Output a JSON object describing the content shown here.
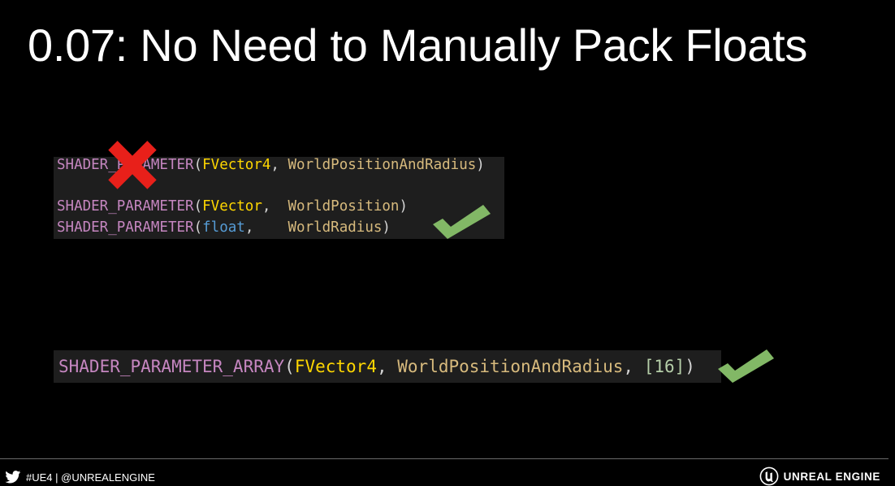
{
  "slide": {
    "title": "0.07: No Need to Manually Pack Floats"
  },
  "code_block_1": {
    "line_1": {
      "macro": "SHADER_PARAMETER",
      "open": "(",
      "type": "FVector4",
      "sep": ", ",
      "name": "WorldPositionAndRadius",
      "close": ")"
    },
    "line_2": {
      "macro": "SHADER_PARAMETER",
      "open": "(",
      "type": "FVector",
      "sep": ",  ",
      "name": "WorldPosition",
      "close": ")"
    },
    "line_3": {
      "macro": "SHADER_PARAMETER",
      "open": "(",
      "type": "float",
      "sep": ",    ",
      "name": "WorldRadius",
      "close": ")"
    }
  },
  "code_block_2": {
    "line_1": {
      "macro": "SHADER_PARAMETER_ARRAY",
      "open": "(",
      "type": "FVector4",
      "sep_1": ", ",
      "name": "WorldPositionAndRadius",
      "sep_2": ", ",
      "size": "[16]",
      "close": ")"
    }
  },
  "marks": {
    "cross_icon": "red-cross-icon",
    "check_icon": "green-check-icon",
    "cross_color": "#e8201a",
    "check_color": "#82b866"
  },
  "footer": {
    "social_icon": "twitter-bird-icon",
    "hashtag_text": "#UE4 | @UNREALENGINE",
    "brand_icon": "unreal-engine-logo-icon",
    "brand_text": "UNREAL ENGINE"
  },
  "colors": {
    "background": "#000000",
    "code_background": "#1e1e1e",
    "macro": "#c586c0",
    "type": "#ffd700",
    "builtin_type": "#569cd6",
    "identifier": "#d7ba7d",
    "punctuation": "#d4d4d4",
    "number": "#b5cea8"
  }
}
